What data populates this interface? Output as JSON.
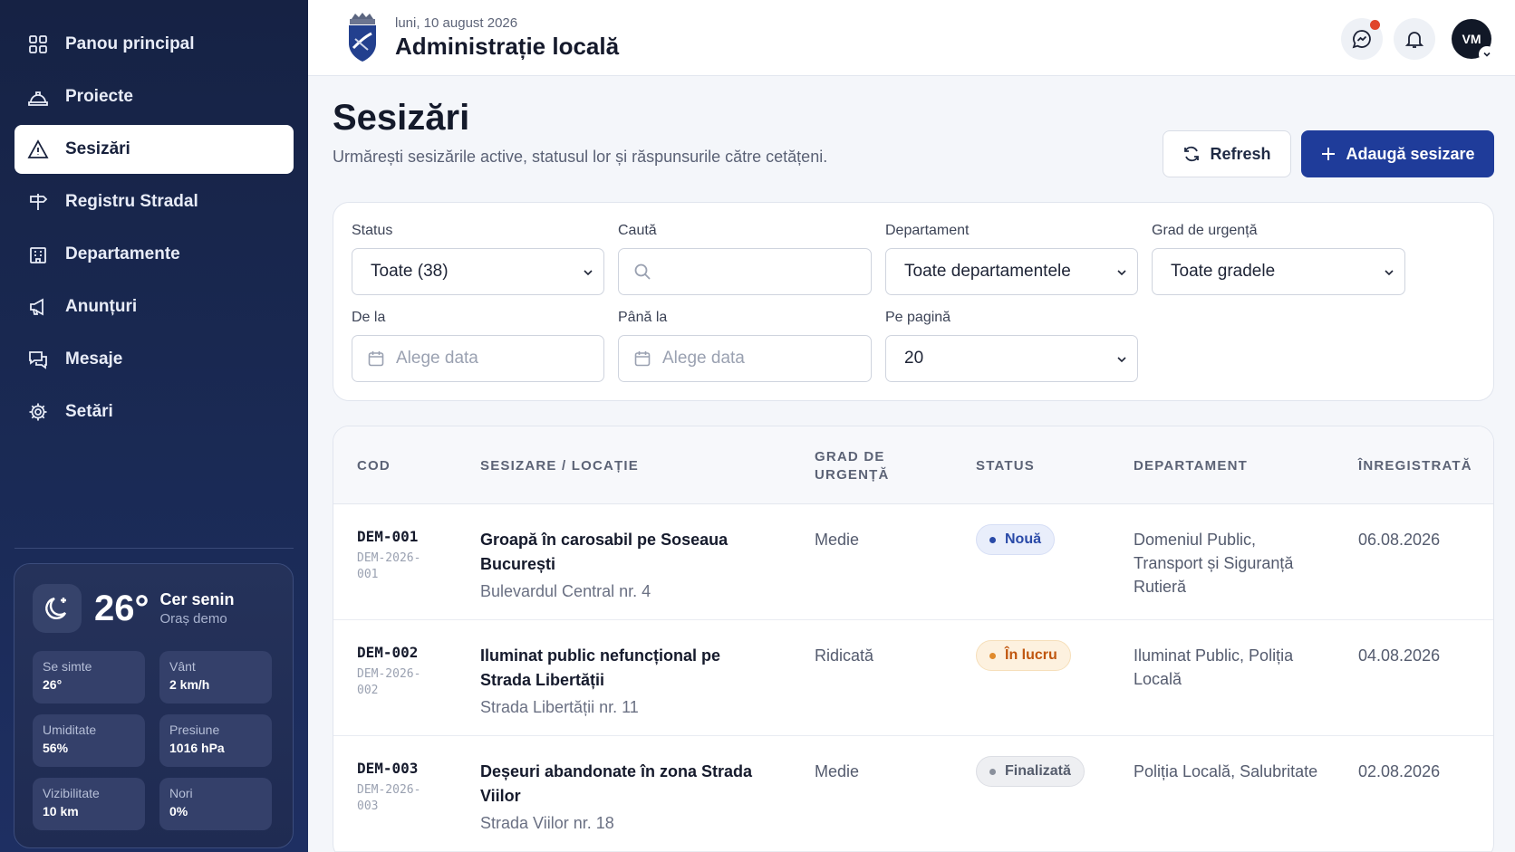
{
  "sidebar": {
    "items": [
      {
        "label": "Panou principal",
        "icon": "grid-icon"
      },
      {
        "label": "Proiecte",
        "icon": "hard-hat-icon"
      },
      {
        "label": "Sesizări",
        "icon": "warning-triangle-icon",
        "active": true
      },
      {
        "label": "Registru Stradal",
        "icon": "signpost-icon"
      },
      {
        "label": "Departamente",
        "icon": "building-icon"
      },
      {
        "label": "Anunțuri",
        "icon": "megaphone-icon"
      },
      {
        "label": "Mesaje",
        "icon": "chat-icon"
      },
      {
        "label": "Setări",
        "icon": "gear-icon"
      }
    ],
    "weather": {
      "temperature": "26°",
      "condition": "Cer senin",
      "location": "Oraș demo",
      "stats": [
        {
          "label": "Se simte",
          "value": "26°"
        },
        {
          "label": "Vânt",
          "value": "2 km/h"
        },
        {
          "label": "Umiditate",
          "value": "56%"
        },
        {
          "label": "Presiune",
          "value": "1016 hPa"
        },
        {
          "label": "Vizibilitate",
          "value": "10 km"
        },
        {
          "label": "Nori",
          "value": "0%"
        }
      ]
    }
  },
  "header": {
    "date": "luni, 10 august 2026",
    "title": "Administrație locală",
    "avatar_initials": "VM"
  },
  "page": {
    "title": "Sesizări",
    "subtitle": "Urmărești sesizările active, statusul lor și răspunsurile către cetățeni.",
    "refresh_label": "Refresh",
    "add_label": "Adaugă sesizare"
  },
  "filters": {
    "status": {
      "label": "Status",
      "value": "Toate (38)"
    },
    "search": {
      "label": "Caută",
      "placeholder": ""
    },
    "department": {
      "label": "Departament",
      "value": "Toate departamentele"
    },
    "urgency": {
      "label": "Grad de urgență",
      "value": "Toate gradele"
    },
    "from": {
      "label": "De la",
      "placeholder": "Alege data"
    },
    "to": {
      "label": "Până la",
      "placeholder": "Alege data"
    },
    "per_page": {
      "label": "Pe pagină",
      "value": "20"
    }
  },
  "table": {
    "headers": {
      "code": "COD",
      "issue": "SESIZARE / LOCAȚIE",
      "urgency_1": "GRAD DE",
      "urgency_2": "URGENȚĂ",
      "status": "STATUS",
      "department": "DEPARTAMENT",
      "registered": "ÎNREGISTRATĂ"
    },
    "rows": [
      {
        "code": "DEM-001",
        "full_code_1": "DEM-2026-",
        "full_code_2": "001",
        "title": "Groapă în carosabil pe Soseaua București",
        "location": "Bulevardul Central nr. 4",
        "urgency": "Medie",
        "status": "Nouă",
        "status_bg": "#e9eefb",
        "status_fg": "#2a4aa8",
        "status_dot": "#2a4aa8",
        "department": "Domeniul Public, Transport și Siguranță Rutieră",
        "date": "06.08.2026"
      },
      {
        "code": "DEM-002",
        "full_code_1": "DEM-2026-",
        "full_code_2": "002",
        "title": "Iluminat public nefuncțional pe Strada Libertății",
        "location": "Strada Libertății nr. 11",
        "urgency": "Ridicată",
        "status": "În lucru",
        "status_bg": "#fdf1df",
        "status_fg": "#c0560f",
        "status_dot": "#e08a2c",
        "department": "Iluminat Public, Poliția Locală",
        "date": "04.08.2026"
      },
      {
        "code": "DEM-003",
        "full_code_1": "DEM-2026-",
        "full_code_2": "003",
        "title": "Deșeuri abandonate în zona Strada Viilor",
        "location": "Strada Viilor nr. 18",
        "urgency": "Medie",
        "status": "Finalizată",
        "status_bg": "#eeeff2",
        "status_fg": "#555c6c",
        "status_dot": "#8a909c",
        "department": "Poliția Locală, Salubritate",
        "date": "02.08.2026"
      }
    ]
  },
  "colors": {
    "sidebar": "#1a2a55",
    "primary": "#1f3c9a",
    "notification": "#e0452b"
  }
}
